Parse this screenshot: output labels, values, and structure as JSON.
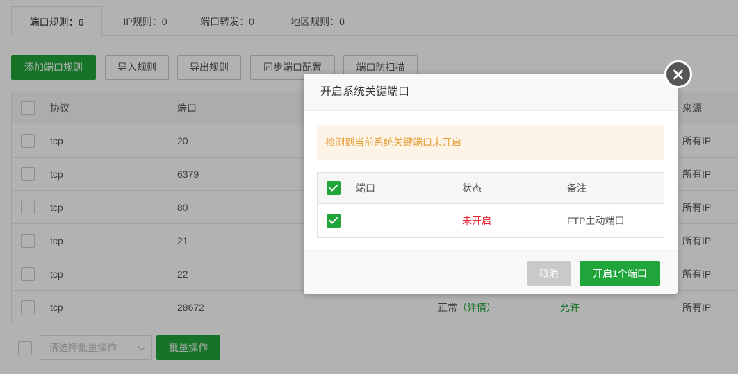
{
  "tabs": [
    {
      "label": "端口规则：6"
    },
    {
      "label": "IP规则：0"
    },
    {
      "label": "端口转发：0"
    },
    {
      "label": "地区规则：0"
    }
  ],
  "toolbar": {
    "add": "添加端口规则",
    "import": "导入规则",
    "export": "导出规则",
    "sync": "同步端口配置",
    "scan": "端口防扫描"
  },
  "table": {
    "headers": {
      "protocol": "协议",
      "port": "端口",
      "source": "来源"
    },
    "rows": [
      {
        "protocol": "tcp",
        "port": "20",
        "status": "",
        "detail": "",
        "policy": "",
        "source": "所有IP"
      },
      {
        "protocol": "tcp",
        "port": "6379",
        "status": "",
        "detail": "",
        "policy": "",
        "source": "所有IP"
      },
      {
        "protocol": "tcp",
        "port": "80",
        "status": "",
        "detail": "",
        "policy": "",
        "source": "所有IP"
      },
      {
        "protocol": "tcp",
        "port": "21",
        "status": "",
        "detail": "",
        "policy": "",
        "source": "所有IP"
      },
      {
        "protocol": "tcp",
        "port": "22",
        "status": "",
        "detail": "",
        "policy": "",
        "source": "所有IP"
      },
      {
        "protocol": "tcp",
        "port": "28672",
        "status": "正常",
        "detail": "（详情）",
        "policy": "允许",
        "source": "所有IP"
      }
    ]
  },
  "batch": {
    "placeholder": "请选择批量操作",
    "button": "批量操作"
  },
  "modal": {
    "title": "开启系统关键端口",
    "alert": "检测到当前系统关键端口未开启",
    "headers": {
      "port": "端口",
      "status": "状态",
      "note": "备注"
    },
    "rows": [
      {
        "port": "",
        "status": "未开启",
        "note": "FTP主动端口"
      }
    ],
    "cancel": "取消",
    "confirm": "开启1个端口"
  },
  "colors": {
    "accent": "#20a53a",
    "danger": "#e8212f",
    "warning": "#e6a23c"
  }
}
